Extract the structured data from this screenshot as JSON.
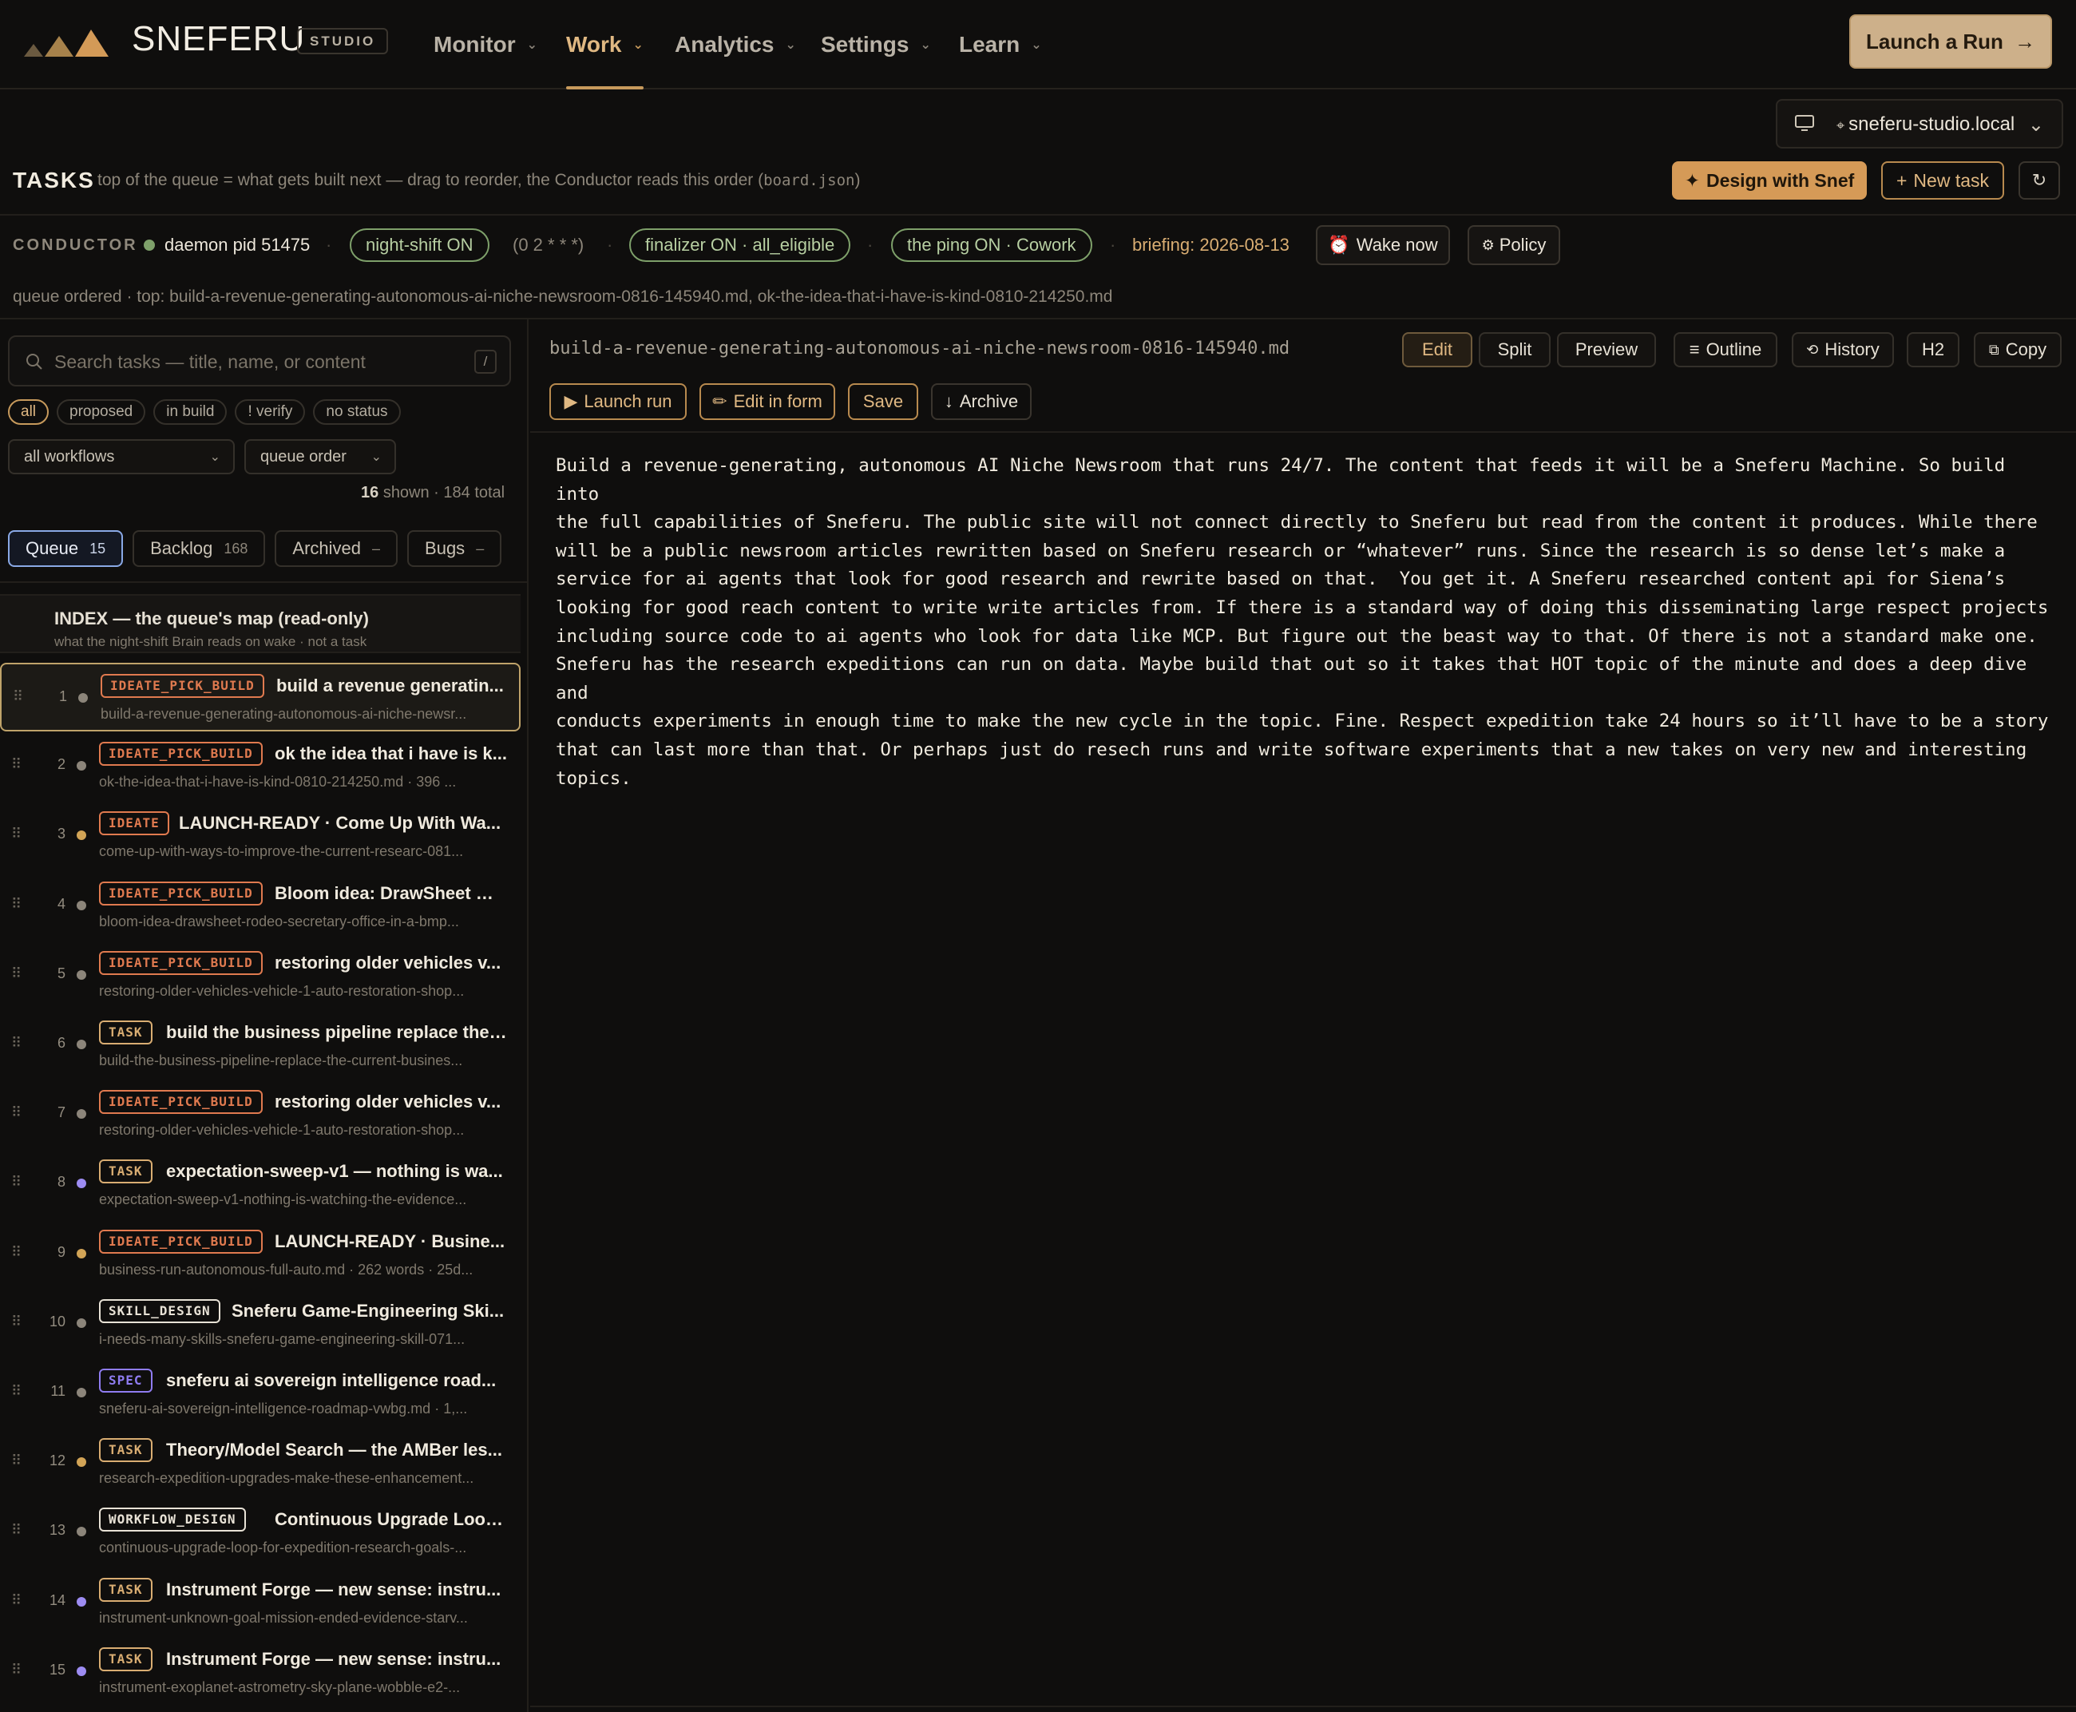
{
  "app": {
    "brand": "SNEFERU",
    "studio": "STUDIO"
  },
  "nav": [
    {
      "label": "Monitor",
      "active": false
    },
    {
      "label": "Work",
      "active": true
    },
    {
      "label": "Analytics",
      "active": false
    },
    {
      "label": "Settings",
      "active": false
    },
    {
      "label": "Learn",
      "active": false
    }
  ],
  "header": {
    "launch_label": "Launch a Run",
    "host": "sneferu-studio.local"
  },
  "tasks": {
    "title": "TASKS",
    "subtitle_pre": "top of the queue = what gets built next — drag to reorder, the Conductor reads this order (",
    "subtitle_code": "board.json",
    "subtitle_post": ")",
    "design_label": "Design with Snef",
    "new_label": "New task",
    "refresh_glyph": "↻"
  },
  "conductor": {
    "label": "CONDUCTOR",
    "daemon": "daemon pid 51475",
    "night_shift": "night-shift ON",
    "cron": "(0 2 * * *)",
    "finalizer": "finalizer ON · all_eligible",
    "ping": "the ping ON · Cowork",
    "briefing": "briefing: 2026-08-13",
    "wake_label": "Wake now",
    "policy_label": "Policy",
    "queue_ordered": "queue ordered · top: build-a-revenue-generating-autonomous-ai-niche-newsroom-0816-145940.md, ok-the-idea-that-i-have-is-kind-0810-214250.md"
  },
  "sidebar": {
    "search_placeholder": "Search tasks — title, name, or content",
    "search_key": "/",
    "filters": [
      "all",
      "proposed",
      "in build",
      "! verify",
      "no status"
    ],
    "workflow_select": "all workflows",
    "order_select": "queue order",
    "shown_count": "16",
    "shown_label": "shown · 184 total",
    "tabs": [
      {
        "label": "Queue",
        "count": "15"
      },
      {
        "label": "Backlog",
        "count": "168"
      },
      {
        "label": "Archived",
        "count": "–"
      },
      {
        "label": "Bugs",
        "count": "–"
      }
    ],
    "index_title": "INDEX — the queue's map (read-only)",
    "index_sub": "what the night-shift Brain reads on wake · not a task",
    "rows": [
      {
        "num": "1",
        "badge": "IDEATE_PICK_BUILD",
        "title": "build a revenue generatin...",
        "sub": "build-a-revenue-generating-autonomous-ai-niche-newsr..."
      },
      {
        "num": "2",
        "badge": "IDEATE_PICK_BUILD",
        "title": "ok the idea that i have is k...",
        "sub": "ok-the-idea-that-i-have-is-kind-0810-214250.md · 396 ..."
      },
      {
        "num": "3",
        "badge": "IDEATE",
        "title": "LAUNCH-READY · Come Up With Wa...",
        "sub": "come-up-with-ways-to-improve-the-current-researc-081..."
      },
      {
        "num": "4",
        "badge": "IDEATE_PICK_BUILD",
        "title": "Bloom idea: DrawSheet —...",
        "sub": "bloom-idea-drawsheet-rodeo-secretary-office-in-a-bmp..."
      },
      {
        "num": "5",
        "badge": "IDEATE_PICK_BUILD",
        "title": "restoring older vehicles v...",
        "sub": "restoring-older-vehicles-vehicle-1-auto-restoration-shop..."
      },
      {
        "num": "6",
        "badge": "TASK",
        "title": "build the business pipeline replace the ...",
        "sub": "build-the-business-pipeline-replace-the-current-busines..."
      },
      {
        "num": "7",
        "badge": "IDEATE_PICK_BUILD",
        "title": "restoring older vehicles v...",
        "sub": "restoring-older-vehicles-vehicle-1-auto-restoration-shop..."
      },
      {
        "num": "8",
        "badge": "TASK",
        "title": "expectation-sweep-v1 — nothing is wa...",
        "sub": "expectation-sweep-v1-nothing-is-watching-the-evidence..."
      },
      {
        "num": "9",
        "badge": "IDEATE_PICK_BUILD",
        "title": "LAUNCH-READY · Busine...",
        "sub": "business-run-autonomous-full-auto.md · 262 words · 25d..."
      },
      {
        "num": "10",
        "badge": "SKILL_DESIGN",
        "title": "Sneferu Game-Engineering Ski...",
        "sub": "i-needs-many-skills-sneferu-game-engineering-skill-071..."
      },
      {
        "num": "11",
        "badge": "SPEC",
        "title": "sneferu ai sovereign intelligence road...",
        "sub": "sneferu-ai-sovereign-intelligence-roadmap-vwbg.md · 1,..."
      },
      {
        "num": "12",
        "badge": "TASK",
        "title": "Theory/Model Search — the AMBer les...",
        "sub": "research-expedition-upgrades-make-these-enhancement..."
      },
      {
        "num": "13",
        "badge": "WORKFLOW_DESIGN",
        "title": "Continuous Upgrade Loop...",
        "sub": "continuous-upgrade-loop-for-expedition-research-goals-..."
      },
      {
        "num": "14",
        "badge": "TASK",
        "title": "Instrument Forge — new sense: instru...",
        "sub": "instrument-unknown-goal-mission-ended-evidence-starv..."
      },
      {
        "num": "15",
        "badge": "TASK",
        "title": "Instrument Forge — new sense: instru...",
        "sub": "instrument-exoplanet-astrometry-sky-plane-wobble-e2-..."
      }
    ]
  },
  "editor": {
    "filename": "build-a-revenue-generating-autonomous-ai-niche-newsroom-0816-145940.md",
    "view_buttons": [
      "Edit",
      "Split",
      "Preview"
    ],
    "outline_label": "Outline",
    "history_label": "History",
    "h2_label": "H2",
    "copy_label": "Copy",
    "launch_run_label": "Launch run",
    "edit_form_label": "Edit in form",
    "save_label": "Save",
    "archive_label": "Archive",
    "content": "Build a revenue-generating, autonomous AI Niche Newsroom that runs 24/7. The content that feeds it will be a Sneferu Machine. So build into\nthe full capabilities of Sneferu. The public site will not connect directly to Sneferu but read from the content it produces. While there\nwill be a public newsroom articles rewritten based on Sneferu research or “whatever” runs. Since the research is so dense let’s make a\nservice for ai agents that look for good research and rewrite based on that.  You get it. A Sneferu researched content api for Siena’s\nlooking for good reach content to write write articles from. If there is a standard way of doing this disseminating large respect projects\nincluding source code to ai agents who look for data like MCP. But figure out the beast way to that. Of there is not a standard make one.\nSneferu has the research expeditions can run on data. Maybe build that out so it takes that HOT topic of the minute and does a deep dive and\nconducts experiments in enough time to make the new cycle in the topic. Fine. Respect expedition take 24 hours so it’ll have to be a story\nthat can last more than that. Or perhaps just do resech runs and write software experiments that a new takes on very new and interesting\ntopics."
  },
  "colors": {
    "accent": "#c79a5c",
    "green": "#7ea06a",
    "badge_orange": "#e07a4f",
    "badge_gold": "#d9ad72",
    "badge_white": "#e8e2d6",
    "badge_purple": "#8f7cf0",
    "dot_gray": "#8c857a",
    "dot_gold": "#d2a456",
    "dot_purple": "#9d8cf2"
  }
}
